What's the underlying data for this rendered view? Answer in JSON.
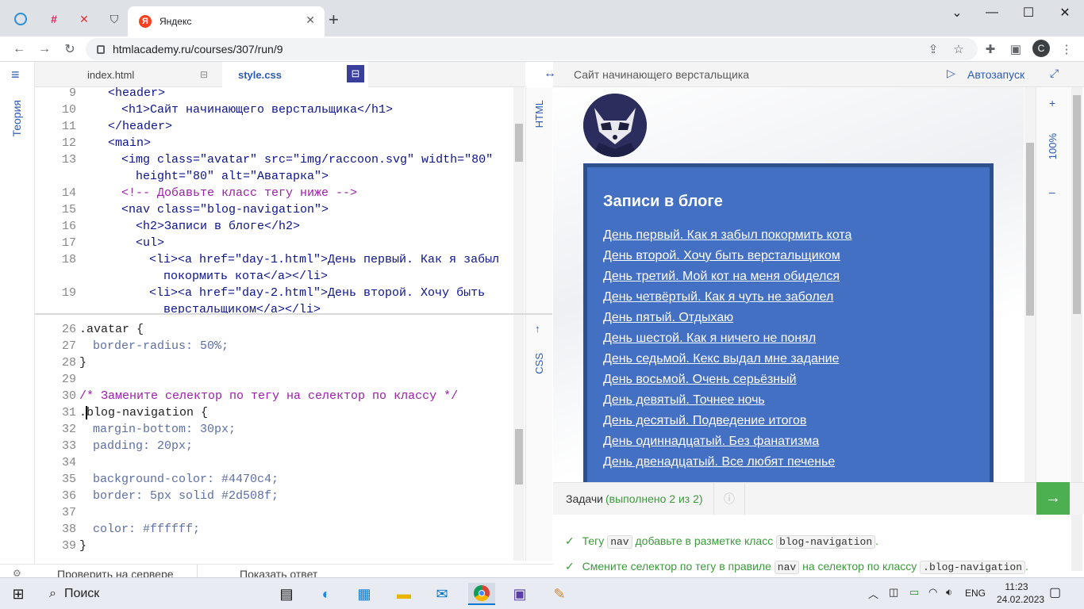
{
  "browser": {
    "active_tab_title": "Яндекс",
    "url": "htmlacademy.ru/courses/307/run/9",
    "profile_initial": "C"
  },
  "app": {
    "sidebar_label": "Теория",
    "tabs": {
      "html": "index.html",
      "css": "style.css"
    },
    "rails": {
      "html": "HTML",
      "css": "CSS"
    },
    "preview_title": "Сайт начинающего верстальщика",
    "autorun": "Автозапуск",
    "zoom": "100%",
    "zoom_plus": "+",
    "zoom_minus": "–"
  },
  "html_lines": [
    {
      "n": "9",
      "t": "<header>"
    },
    {
      "n": "10",
      "t": "<h1>Сайт начинающего верстальщика</h1>"
    },
    {
      "n": "11",
      "t": "</header>"
    },
    {
      "n": "12",
      "t": "<main>"
    },
    {
      "n": "13",
      "t": "<img class=\"avatar\" src=\"img/raccoon.svg\" width=\"80\""
    },
    {
      "n": "",
      "t": "height=\"80\" alt=\"Аватарка\">"
    },
    {
      "n": "14",
      "t": "<!-- Добавьте класс тегу ниже -->"
    },
    {
      "n": "15",
      "t": "<nav class=\"blog-navigation\">"
    },
    {
      "n": "16",
      "t": "<h2>Записи в блоге</h2>"
    },
    {
      "n": "17",
      "t": "<ul>"
    },
    {
      "n": "18",
      "t": "<li><a href=\"day-1.html\">День первый. Как я забыл"
    },
    {
      "n": "",
      "t": "покормить кота</a></li>"
    },
    {
      "n": "19",
      "t": "<li><a href=\"day-2.html\">День второй. Хочу быть"
    },
    {
      "n": "",
      "t": "верстальщиком</a></li>"
    }
  ],
  "css_lines": [
    {
      "n": "26",
      "t": ".avatar {"
    },
    {
      "n": "27",
      "t": "border-radius: 50%;"
    },
    {
      "n": "28",
      "t": "}"
    },
    {
      "n": "29",
      "t": ""
    },
    {
      "n": "30",
      "t": "/* Замените селектор по тегу на селектор по классу */"
    },
    {
      "n": "31",
      "t": ".blog-navigation {"
    },
    {
      "n": "32",
      "t": "margin-bottom: 30px;"
    },
    {
      "n": "33",
      "t": "padding: 20px;"
    },
    {
      "n": "34",
      "t": ""
    },
    {
      "n": "35",
      "t": "background-color: #4470c4;"
    },
    {
      "n": "36",
      "t": "border: 5px solid #2d508f;"
    },
    {
      "n": "37",
      "t": ""
    },
    {
      "n": "38",
      "t": "color: #ffffff;"
    },
    {
      "n": "39",
      "t": "}"
    }
  ],
  "preview": {
    "heading": "Записи в блоге",
    "links": [
      "День первый. Как я забыл покормить кота",
      "День второй. Хочу быть верстальщиком",
      "День третий. Мой кот на меня обиделся",
      "День четвёртый. Как я чуть не заболел",
      "День пятый. Отдыхаю",
      "День шестой. Как я ничего не понял",
      "День седьмой. Кекс выдал мне задание",
      "День восьмой. Очень серьёзный",
      "День девятый. Точнее ночь",
      "День десятый. Подведение итогов",
      "День одиннадцатый. Без фанатизма",
      "День двенадцатый. Все любят печенье"
    ]
  },
  "tasks": {
    "label": "Задачи",
    "progress": "(выполнено 2 из 2)",
    "t1": {
      "a": "Тегу",
      "b": "nav",
      "c": "добавьте в разметке класс",
      "d": "blog-navigation",
      "e": "."
    },
    "t2": {
      "a": "Смените селектор по тегу в правиле",
      "b": "nav",
      "c": "на селектор по классу",
      "d": ".blog-navigation",
      "e": "."
    }
  },
  "bottom_buttons": {
    "check": "Проверить на сервере",
    "answer": "Показать ответ"
  },
  "taskbar": {
    "search_placeholder": "Поиск",
    "time": "11:23",
    "date": "24.02.2023",
    "lang": "ENG"
  }
}
